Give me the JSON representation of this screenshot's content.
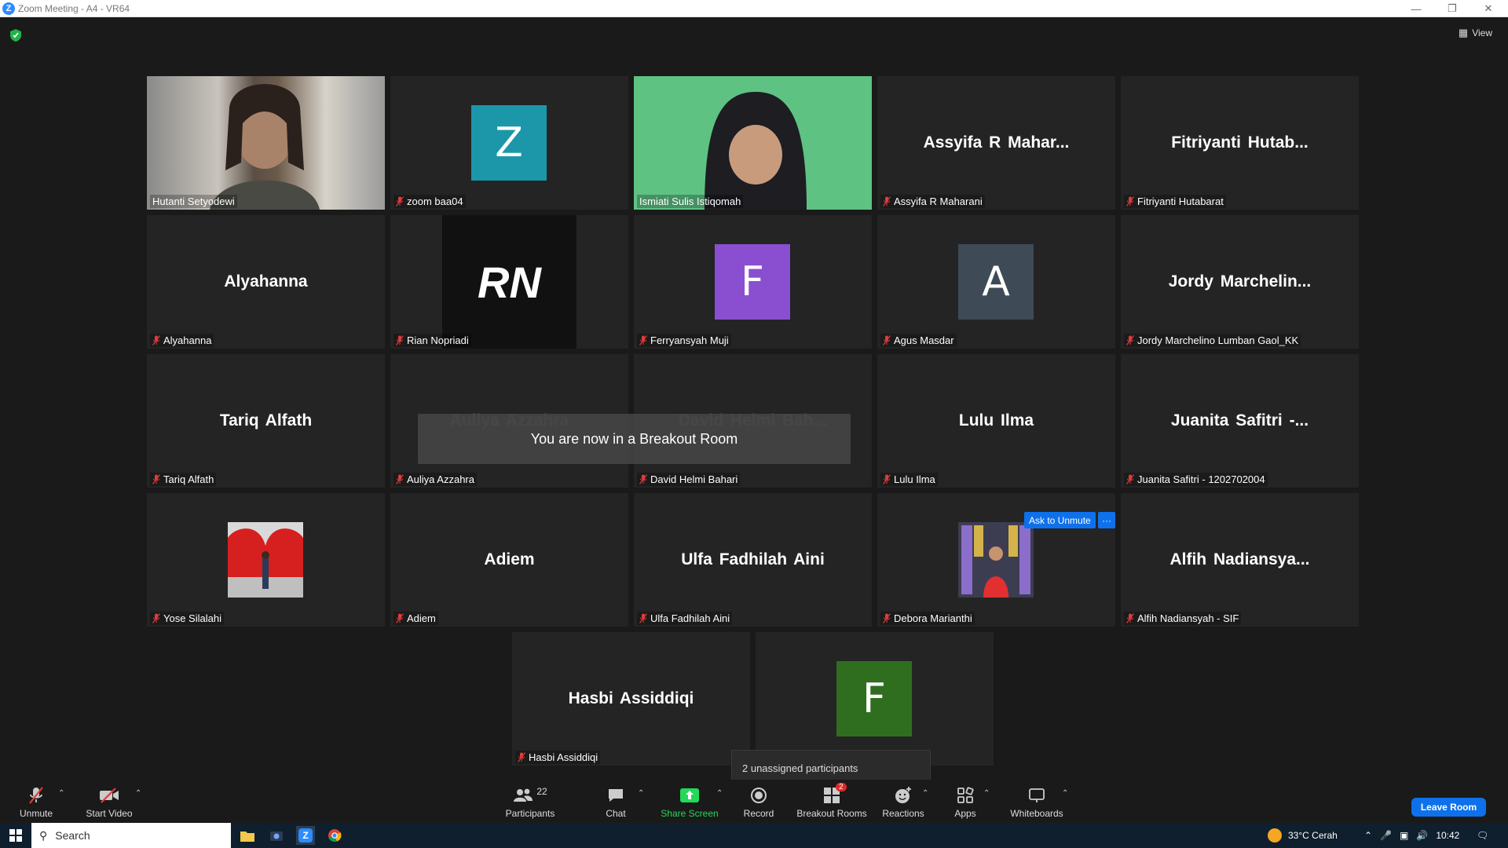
{
  "window": {
    "title": "Zoom Meeting - A4 - VR64"
  },
  "header": {
    "view_label": "View"
  },
  "tiles": [
    {
      "display_name": "",
      "label": "Hutanti Setyodewi",
      "muted": false,
      "kind": "video"
    },
    {
      "display_name": "",
      "label": "zoom baa04",
      "muted": true,
      "kind": "avatar",
      "avatar_letter": "Z",
      "avatar_color": "#1b97a9"
    },
    {
      "display_name": "",
      "label": "Ismiati Sulis Istiqomah",
      "muted": false,
      "kind": "video",
      "active": true
    },
    {
      "display_name": "Assyifa R Mahar...",
      "label": "Assyifa R Maharani",
      "muted": true,
      "kind": "name"
    },
    {
      "display_name": "Fitriyanti Hutab...",
      "label": "Fitriyanti Hutabarat",
      "muted": true,
      "kind": "name"
    },
    {
      "display_name": "Alyahanna",
      "label": "Alyahanna",
      "muted": true,
      "kind": "name"
    },
    {
      "display_name": "RN",
      "label": "Rian Nopriadi",
      "muted": true,
      "kind": "logo"
    },
    {
      "display_name": "",
      "label": "Ferryansyah Muji",
      "muted": true,
      "kind": "avatar",
      "avatar_letter": "F",
      "avatar_color": "#8a4fd0"
    },
    {
      "display_name": "",
      "label": "Agus Masdar",
      "muted": true,
      "kind": "avatar",
      "avatar_letter": "A",
      "avatar_color": "#3e4b56"
    },
    {
      "display_name": "Jordy Marchelin...",
      "label": "Jordy Marchelino Lumban Gaol_KK",
      "muted": true,
      "kind": "name"
    },
    {
      "display_name": "Tariq Alfath",
      "label": "Tariq Alfath",
      "muted": true,
      "kind": "name"
    },
    {
      "display_name": "Auliya Azzahra",
      "label": "Auliya Azzahra",
      "muted": true,
      "kind": "name"
    },
    {
      "display_name": "David Helmi Bah...",
      "label": "David Helmi Bahari",
      "muted": true,
      "kind": "name"
    },
    {
      "display_name": "Lulu Ilma",
      "label": "Lulu Ilma",
      "muted": true,
      "kind": "name"
    },
    {
      "display_name": "Juanita Safitri -...",
      "label": "Juanita Safitri - 1202702004",
      "muted": true,
      "kind": "name"
    },
    {
      "display_name": "",
      "label": "Yose Silalahi",
      "muted": true,
      "kind": "photo"
    },
    {
      "display_name": "Adiem",
      "label": "Adiem",
      "muted": true,
      "kind": "name"
    },
    {
      "display_name": "Ulfa Fadhilah Aini",
      "label": "Ulfa Fadhilah Aini",
      "muted": true,
      "kind": "name"
    },
    {
      "display_name": "",
      "label": "Debora Marianthi",
      "muted": true,
      "kind": "photo"
    },
    {
      "display_name": "Alfih Nadiansya...",
      "label": "Alfih Nadiansyah - SIF",
      "muted": true,
      "kind": "name"
    },
    {
      "display_name": "Hasbi Assiddiqi",
      "label": "Hasbi Assiddiqi",
      "muted": true,
      "kind": "name"
    },
    {
      "display_name": "",
      "label": "",
      "muted": false,
      "kind": "avatar",
      "avatar_letter": "F",
      "avatar_color": "#2f6e1f"
    }
  ],
  "overlay": {
    "breakout_message": "You are now in a Breakout Room",
    "ask_to_unmute": "Ask to Unmute",
    "more": "···",
    "unassigned_tooltip": "2 unassigned participants"
  },
  "toolbar": {
    "unmute": "Unmute",
    "start_video": "Start Video",
    "participants": "Participants",
    "participants_count": "22",
    "chat": "Chat",
    "share_screen": "Share Screen",
    "record": "Record",
    "breakout_rooms": "Breakout Rooms",
    "breakout_badge": "2",
    "reactions": "Reactions",
    "apps": "Apps",
    "whiteboards": "Whiteboards",
    "leave_room": "Leave Room",
    "share_color": "#23d959"
  },
  "taskbar": {
    "search": "Search",
    "weather": "33°C  Cerah",
    "time": "10:42"
  }
}
